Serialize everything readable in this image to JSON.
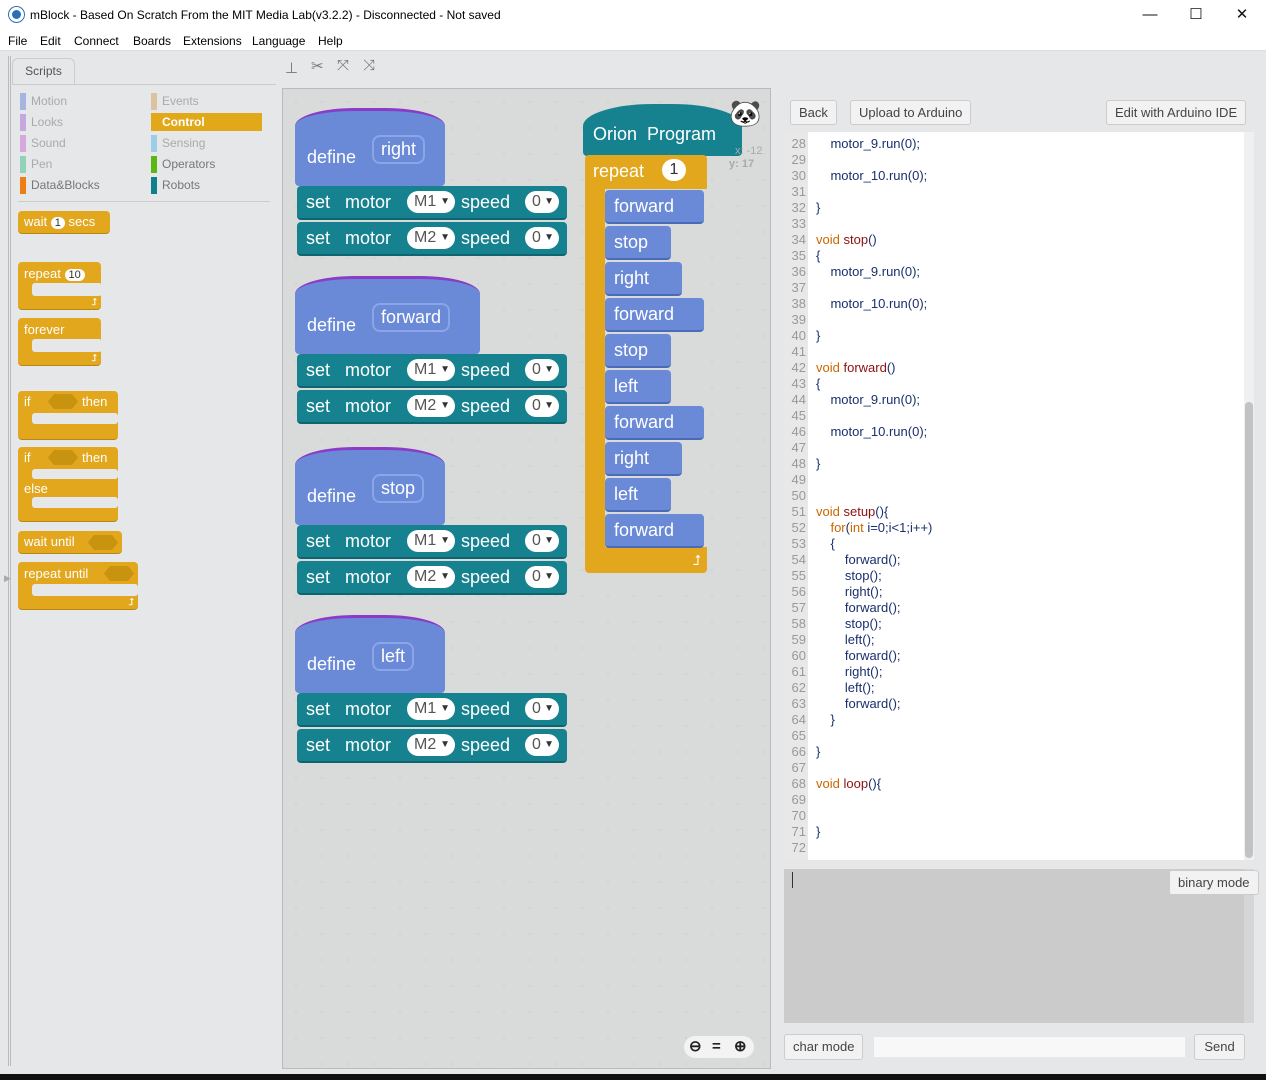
{
  "window": {
    "title": "mBlock - Based On Scratch From the MIT Media Lab(v3.2.2) - Disconnected - Not saved",
    "minimize": "—",
    "maximize": "☐",
    "close": "✕"
  },
  "menu": [
    "File",
    "Edit",
    "Connect",
    "Boards",
    "Extensions",
    "Language",
    "Help"
  ],
  "tabs": {
    "scripts": "Scripts"
  },
  "toolbar_icons": [
    "stamp-icon",
    "scissors-icon",
    "grow-icon",
    "shrink-icon"
  ],
  "categories": {
    "left": [
      {
        "label": "Motion",
        "color": "#a7b4e0"
      },
      {
        "label": "Looks",
        "color": "#c4a8e0"
      },
      {
        "label": "Sound",
        "color": "#d7a8dd"
      },
      {
        "label": "Pen",
        "color": "#93d1b8"
      },
      {
        "label": "Data&Blocks",
        "color": "#ee7d16"
      }
    ],
    "right": [
      {
        "label": "Events",
        "color": "#dcc3a0"
      },
      {
        "label": "Control",
        "color": "#e1a91a",
        "selected": true
      },
      {
        "label": "Sensing",
        "color": "#9ccde9"
      },
      {
        "label": "Operators",
        "color": "#5cb712"
      },
      {
        "label": "Robots",
        "color": "#0e7f8c"
      }
    ]
  },
  "palette": {
    "wait": "wait",
    "wait_val": "1",
    "secs": "secs",
    "repeat": "repeat",
    "repeat_val": "10",
    "forever": "forever",
    "if": "if",
    "then": "then",
    "else": "else",
    "wait_until": "wait until",
    "repeat_until": "repeat until"
  },
  "defines": [
    {
      "define": "define",
      "name": "right",
      "set": "set",
      "motor": "motor",
      "speed": "speed",
      "m1": "M1",
      "m2": "M2",
      "v1": "0",
      "v2": "0"
    },
    {
      "define": "define",
      "name": "forward",
      "set": "set",
      "motor": "motor",
      "speed": "speed",
      "m1": "M1",
      "m2": "M2",
      "v1": "0",
      "v2": "0"
    },
    {
      "define": "define",
      "name": "stop",
      "set": "set",
      "motor": "motor",
      "speed": "speed",
      "m1": "M1",
      "m2": "M2",
      "v1": "0",
      "v2": "0"
    },
    {
      "define": "define",
      "name": "left",
      "set": "set",
      "motor": "motor",
      "speed": "speed",
      "m1": "M1",
      "m2": "M2",
      "v1": "0",
      "v2": "0"
    }
  ],
  "program": {
    "hat": "Orion  Program",
    "repeat": "repeat",
    "repeat_val": "1",
    "calls": [
      "forward",
      "stop",
      "right",
      "forward",
      "stop",
      "left",
      "forward",
      "right",
      "left",
      "forward"
    ]
  },
  "sprite": {
    "x": "x: -12",
    "y": "y: 17"
  },
  "zoom": {
    "out": "zoom-out-icon",
    "reset": "=",
    "in": "zoom-in-icon"
  },
  "right_panel": {
    "back": "Back",
    "upload": "Upload to Arduino",
    "edit_ide": "Edit with Arduino IDE",
    "binary_mode": "binary mode",
    "char_mode": "char mode",
    "send": "Send",
    "send_input": ""
  },
  "code": [
    {
      "n": 28,
      "t": "    motor_9.run(0);"
    },
    {
      "n": 29,
      "t": ""
    },
    {
      "n": 30,
      "t": "    motor_10.run(0);"
    },
    {
      "n": 31,
      "t": ""
    },
    {
      "n": 32,
      "t": "}"
    },
    {
      "n": 33,
      "t": ""
    },
    {
      "n": 34,
      "t": "void stop()"
    },
    {
      "n": 35,
      "t": "{"
    },
    {
      "n": 36,
      "t": "    motor_9.run(0);"
    },
    {
      "n": 37,
      "t": ""
    },
    {
      "n": 38,
      "t": "    motor_10.run(0);"
    },
    {
      "n": 39,
      "t": ""
    },
    {
      "n": 40,
      "t": "}"
    },
    {
      "n": 41,
      "t": ""
    },
    {
      "n": 42,
      "t": "void forward()"
    },
    {
      "n": 43,
      "t": "{"
    },
    {
      "n": 44,
      "t": "    motor_9.run(0);"
    },
    {
      "n": 45,
      "t": ""
    },
    {
      "n": 46,
      "t": "    motor_10.run(0);"
    },
    {
      "n": 47,
      "t": ""
    },
    {
      "n": 48,
      "t": "}"
    },
    {
      "n": 49,
      "t": ""
    },
    {
      "n": 50,
      "t": ""
    },
    {
      "n": 51,
      "t": "void setup(){"
    },
    {
      "n": 52,
      "t": "    for(int i=0;i<1;i++)"
    },
    {
      "n": 53,
      "t": "    {"
    },
    {
      "n": 54,
      "t": "        forward();"
    },
    {
      "n": 55,
      "t": "        stop();"
    },
    {
      "n": 56,
      "t": "        right();"
    },
    {
      "n": 57,
      "t": "        forward();"
    },
    {
      "n": 58,
      "t": "        stop();"
    },
    {
      "n": 59,
      "t": "        left();"
    },
    {
      "n": 60,
      "t": "        forward();"
    },
    {
      "n": 61,
      "t": "        right();"
    },
    {
      "n": 62,
      "t": "        left();"
    },
    {
      "n": 63,
      "t": "        forward();"
    },
    {
      "n": 64,
      "t": "    }"
    },
    {
      "n": 65,
      "t": ""
    },
    {
      "n": 66,
      "t": "}"
    },
    {
      "n": 67,
      "t": ""
    },
    {
      "n": 68,
      "t": "void loop(){"
    },
    {
      "n": 69,
      "t": ""
    },
    {
      "n": 70,
      "t": ""
    },
    {
      "n": 71,
      "t": "}"
    },
    {
      "n": 72,
      "t": ""
    }
  ]
}
